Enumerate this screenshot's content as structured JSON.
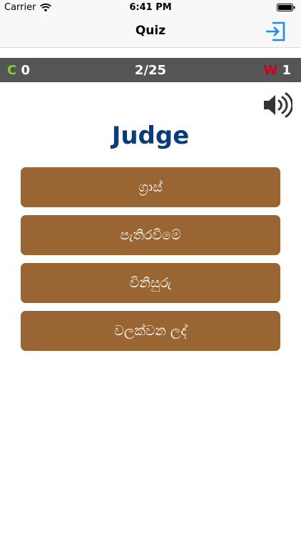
{
  "status_bar": {
    "carrier": "Carrier",
    "time": "6:41 PM"
  },
  "nav": {
    "title": "Quiz",
    "exit_icon": "exit-icon"
  },
  "score": {
    "correct_letter": "C",
    "correct_count": "0",
    "progress": "2/25",
    "wrong_letter": "W",
    "wrong_count": "1"
  },
  "speaker_icon": "speaker-icon",
  "question": {
    "word": "Judge"
  },
  "answers": [
    {
      "label": "ග්‍රාස්"
    },
    {
      "label": "පැතිරවීමේ"
    },
    {
      "label": "විනිසුරු"
    },
    {
      "label": "වලක්වන ලද්"
    }
  ],
  "colors": {
    "answer_bg": "#996633",
    "question_text": "#0b3c7a",
    "score_bar": "#555555",
    "correct_letter": "#7ed321",
    "wrong_letter": "#d0021b",
    "accent": "#1a8cff"
  }
}
